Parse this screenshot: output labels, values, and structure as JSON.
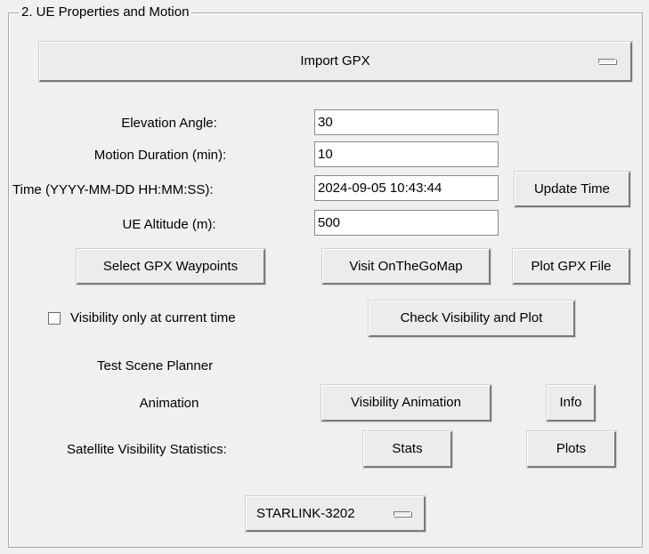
{
  "section_title": "2. UE Properties and Motion",
  "import_menu": {
    "label": "Import GPX",
    "icon": "menu-indicator-icon"
  },
  "fields": {
    "elevation_angle": {
      "label": "Elevation Angle:",
      "value": "30"
    },
    "motion_duration": {
      "label": "Motion Duration (min):",
      "value": "10"
    },
    "time": {
      "label": "Time (YYYY-MM-DD HH:MM:SS):",
      "value": "2024-09-05 10:43:44"
    },
    "ue_altitude": {
      "label": "UE Altitude (m):",
      "value": "500"
    }
  },
  "buttons": {
    "update_time": "Update Time",
    "select_waypoints": "Select GPX Waypoints",
    "visit_map": "Visit OnTheGoMap",
    "plot_gpx": "Plot GPX File",
    "check_visibility": "Check Visibility and Plot",
    "visibility_animation": "Visibility Animation",
    "info": "Info",
    "stats": "Stats",
    "plots": "Plots"
  },
  "checkbox": {
    "label": "Visibility only at current time",
    "checked": false
  },
  "labels": {
    "test_scene_planner": "Test Scene Planner",
    "animation": "Animation",
    "satellite_stats": "Satellite Visibility Statistics:"
  },
  "satellite_menu": {
    "label": "STARLINK-3202",
    "icon": "menu-indicator-icon"
  }
}
